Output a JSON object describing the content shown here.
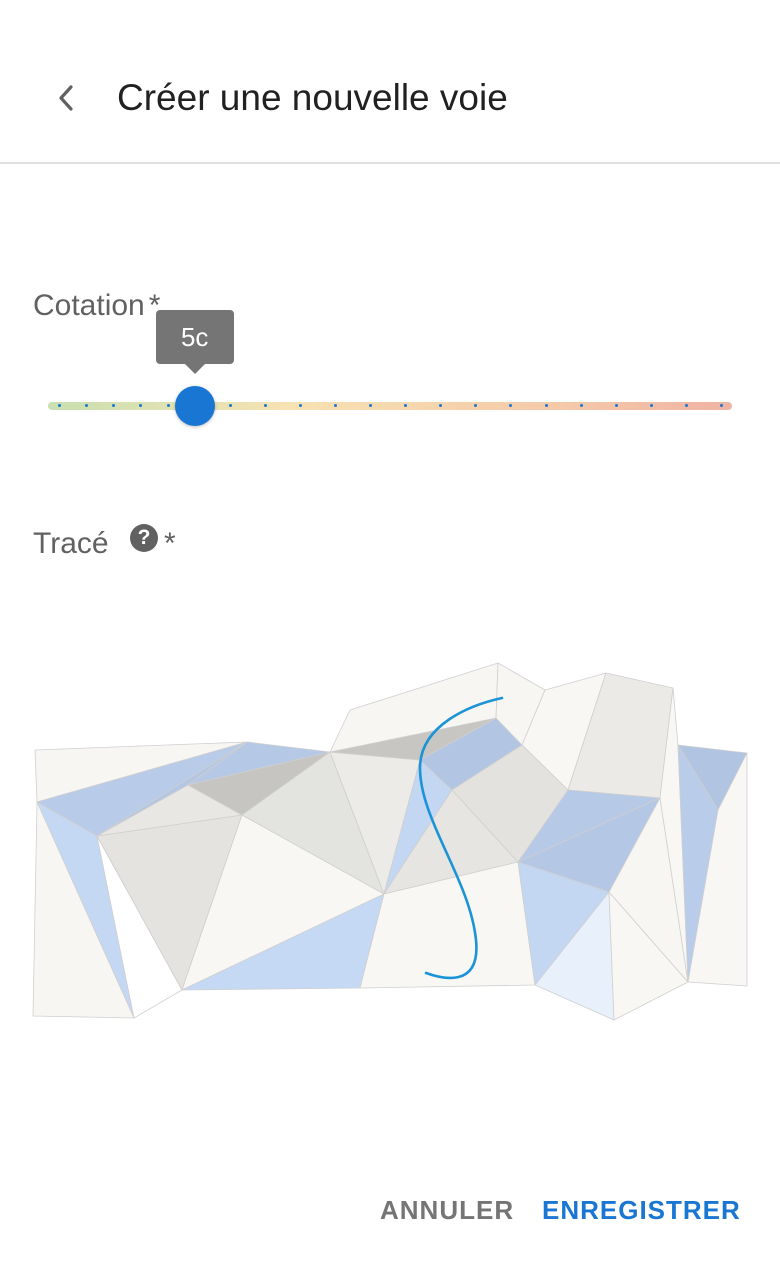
{
  "header": {
    "title": "Créer une nouvelle voie",
    "back_icon": "chevron-left-icon"
  },
  "grade_field": {
    "label": "Cotation",
    "required_mark": "*",
    "current_value": "5c",
    "selected_index": 5,
    "step_count": 21,
    "colors": {
      "thumb": "#1976d2",
      "ticks": "#1976d2",
      "value_label_bg": "#757575"
    }
  },
  "trace_field": {
    "label": "Tracé",
    "required_mark": "*",
    "help_icon": "help-circle-icon",
    "help_glyph": "?"
  },
  "actions": {
    "cancel_label": "ANNULER",
    "save_label": "ENREGISTRER",
    "cancel_color": "#757575",
    "save_color": "#1976d2"
  }
}
